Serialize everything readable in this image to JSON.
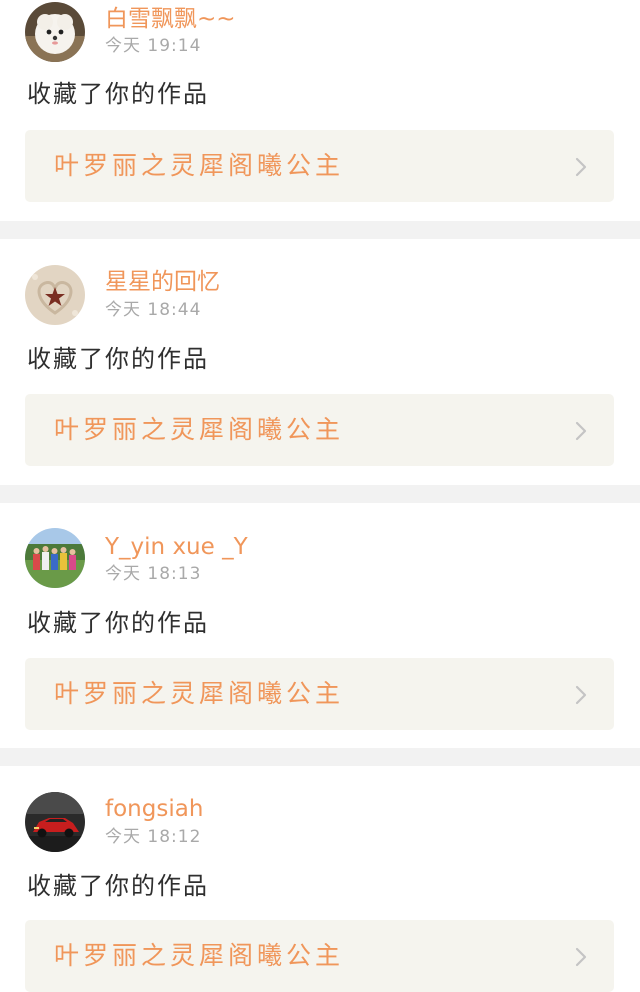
{
  "colors": {
    "accent": "#f0965a",
    "text": "#2f2f2f",
    "muted": "#a9a9a9",
    "link_bg": "#f5f4ee",
    "separator": "#f2f2f2",
    "chevron": "#c4c4c4"
  },
  "notifications": [
    {
      "username": "白雪飘飘~~",
      "time": "今天  19:14",
      "action": "收藏了你的作品",
      "work_title": "叶罗丽之灵犀阁曦公主",
      "avatar_icon": "white-puppy-avatar-icon"
    },
    {
      "username": "星星的回忆",
      "time": "今天  18:44",
      "action": "收藏了你的作品",
      "work_title": "叶罗丽之灵犀阁曦公主",
      "avatar_icon": "sand-heart-star-avatar-icon"
    },
    {
      "username": "Y_yin xue _Y",
      "time": "今天  18:13",
      "action": "收藏了你的作品",
      "work_title": "叶罗丽之灵犀阁曦公主",
      "avatar_icon": "group-photo-avatar-icon"
    },
    {
      "username": "fongsiah",
      "time": "今天  18:12",
      "action": "收藏了你的作品",
      "work_title": "叶罗丽之灵犀阁曦公主",
      "avatar_icon": "red-car-avatar-icon"
    }
  ]
}
